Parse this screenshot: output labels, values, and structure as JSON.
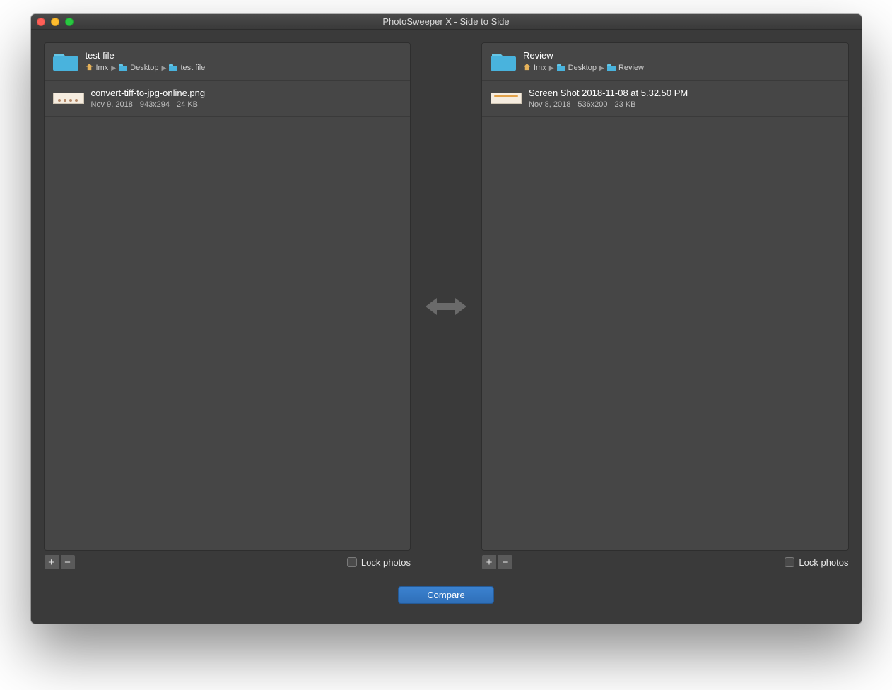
{
  "window": {
    "title": "PhotoSweeper X - Side to Side"
  },
  "left": {
    "folder_name": "test file",
    "breadcrumb": {
      "user": "Imx",
      "mid": "Desktop",
      "leaf": "test file"
    },
    "file": {
      "name": "convert-tiff-to-jpg-online.png",
      "date": "Nov 9, 2018",
      "dimensions": "943x294",
      "size": "24 KB"
    },
    "lock_label": "Lock photos"
  },
  "right": {
    "folder_name": "Review",
    "breadcrumb": {
      "user": "Imx",
      "mid": "Desktop",
      "leaf": "Review"
    },
    "file": {
      "name": "Screen Shot 2018-11-08 at 5.32.50 PM",
      "date": "Nov 8, 2018",
      "dimensions": "536x200",
      "size": "23 KB"
    },
    "lock_label": "Lock photos"
  },
  "compare_label": "Compare"
}
